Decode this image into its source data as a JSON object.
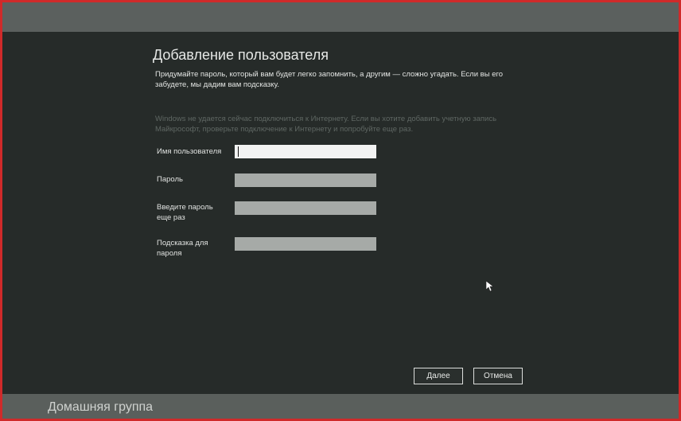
{
  "page": {
    "title": "Добавление пользователя",
    "intro": "Придумайте пароль, который вам будет легко запомнить, а другим — сложно угадать. Если вы его забудете, мы дадим вам подсказку.",
    "notice": "Windows не удается сейчас подключиться к Интернету. Если вы хотите добавить учетную запись Майкрософт, проверьте подключение к Интернету и попробуйте еще раз."
  },
  "form": {
    "username": {
      "label": "Имя пользователя",
      "value": ""
    },
    "password": {
      "label": "Пароль",
      "value": ""
    },
    "password_confirm": {
      "label": "Введите пароль еще раз",
      "value": ""
    },
    "hint": {
      "label": "Подсказка для пароля",
      "value": ""
    }
  },
  "buttons": {
    "next": "Далее",
    "cancel": "Отмена"
  },
  "footer": {
    "label": "Домашняя группа"
  },
  "colors": {
    "background": "#262b29",
    "strip": "#5a5f5c",
    "border": "#cf2a2a"
  }
}
